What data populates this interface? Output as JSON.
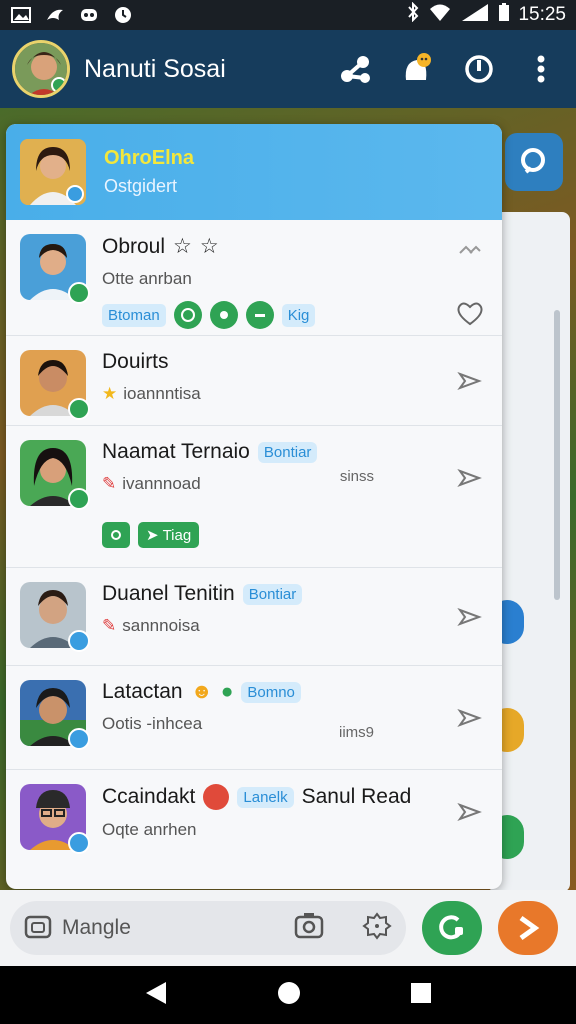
{
  "status_bar": {
    "time": "15:25",
    "icons": [
      "photo-icon",
      "bird-icon",
      "game-icon",
      "clock-icon",
      "bluetooth-icon",
      "wifi-icon",
      "signal-icon",
      "battery-icon"
    ]
  },
  "header": {
    "title": "Nanuti Sosai",
    "actions": [
      "share-icon",
      "notifications-icon",
      "power-icon",
      "more-icon"
    ]
  },
  "panel_head": {
    "name": "OhroElna",
    "sub": "Ostgidert"
  },
  "chats": [
    {
      "name": "Obroul",
      "sub": "Otte anrban",
      "tags": [
        "Btoman",
        "Kig"
      ],
      "action": "heart-icon",
      "badge_color": "#2fa354"
    },
    {
      "name": "Douirts",
      "sub": "ioannntisa",
      "action": "forward-icon",
      "badge_color": "#2fa354"
    },
    {
      "name": "Naamat Ternaio",
      "sub": "ivannnoad",
      "chip": "Bontiar",
      "time": "sinss",
      "green_tag": "Tiag",
      "action": "forward-icon",
      "badge_color": "#2fa354"
    },
    {
      "name": "Duanel Tenitin",
      "sub": "sannnoisa",
      "chip": "Bontiar",
      "action": "forward-icon",
      "badge_color": "#3a9de0"
    },
    {
      "name": "Latactan",
      "sub": "Ootis -inhcea",
      "chip": "Bomno",
      "time": "iims9",
      "action": "forward-icon",
      "badge_color": "#3a9de0"
    },
    {
      "name": "Ccaindakt",
      "sub": "Oqte anrhen",
      "chip": "Lanelk",
      "extra_name": "Sanul Read",
      "action": "forward-icon",
      "badge_color": "#3a9de0"
    }
  ],
  "input_bar": {
    "placeholder": "Mangle"
  },
  "colors": {
    "header_bg": "#163c5c",
    "panel_head": "#4aaee9",
    "accent_green": "#2fa354",
    "accent_orange": "#e8782a",
    "chip_blue": "#2a8ed6"
  }
}
